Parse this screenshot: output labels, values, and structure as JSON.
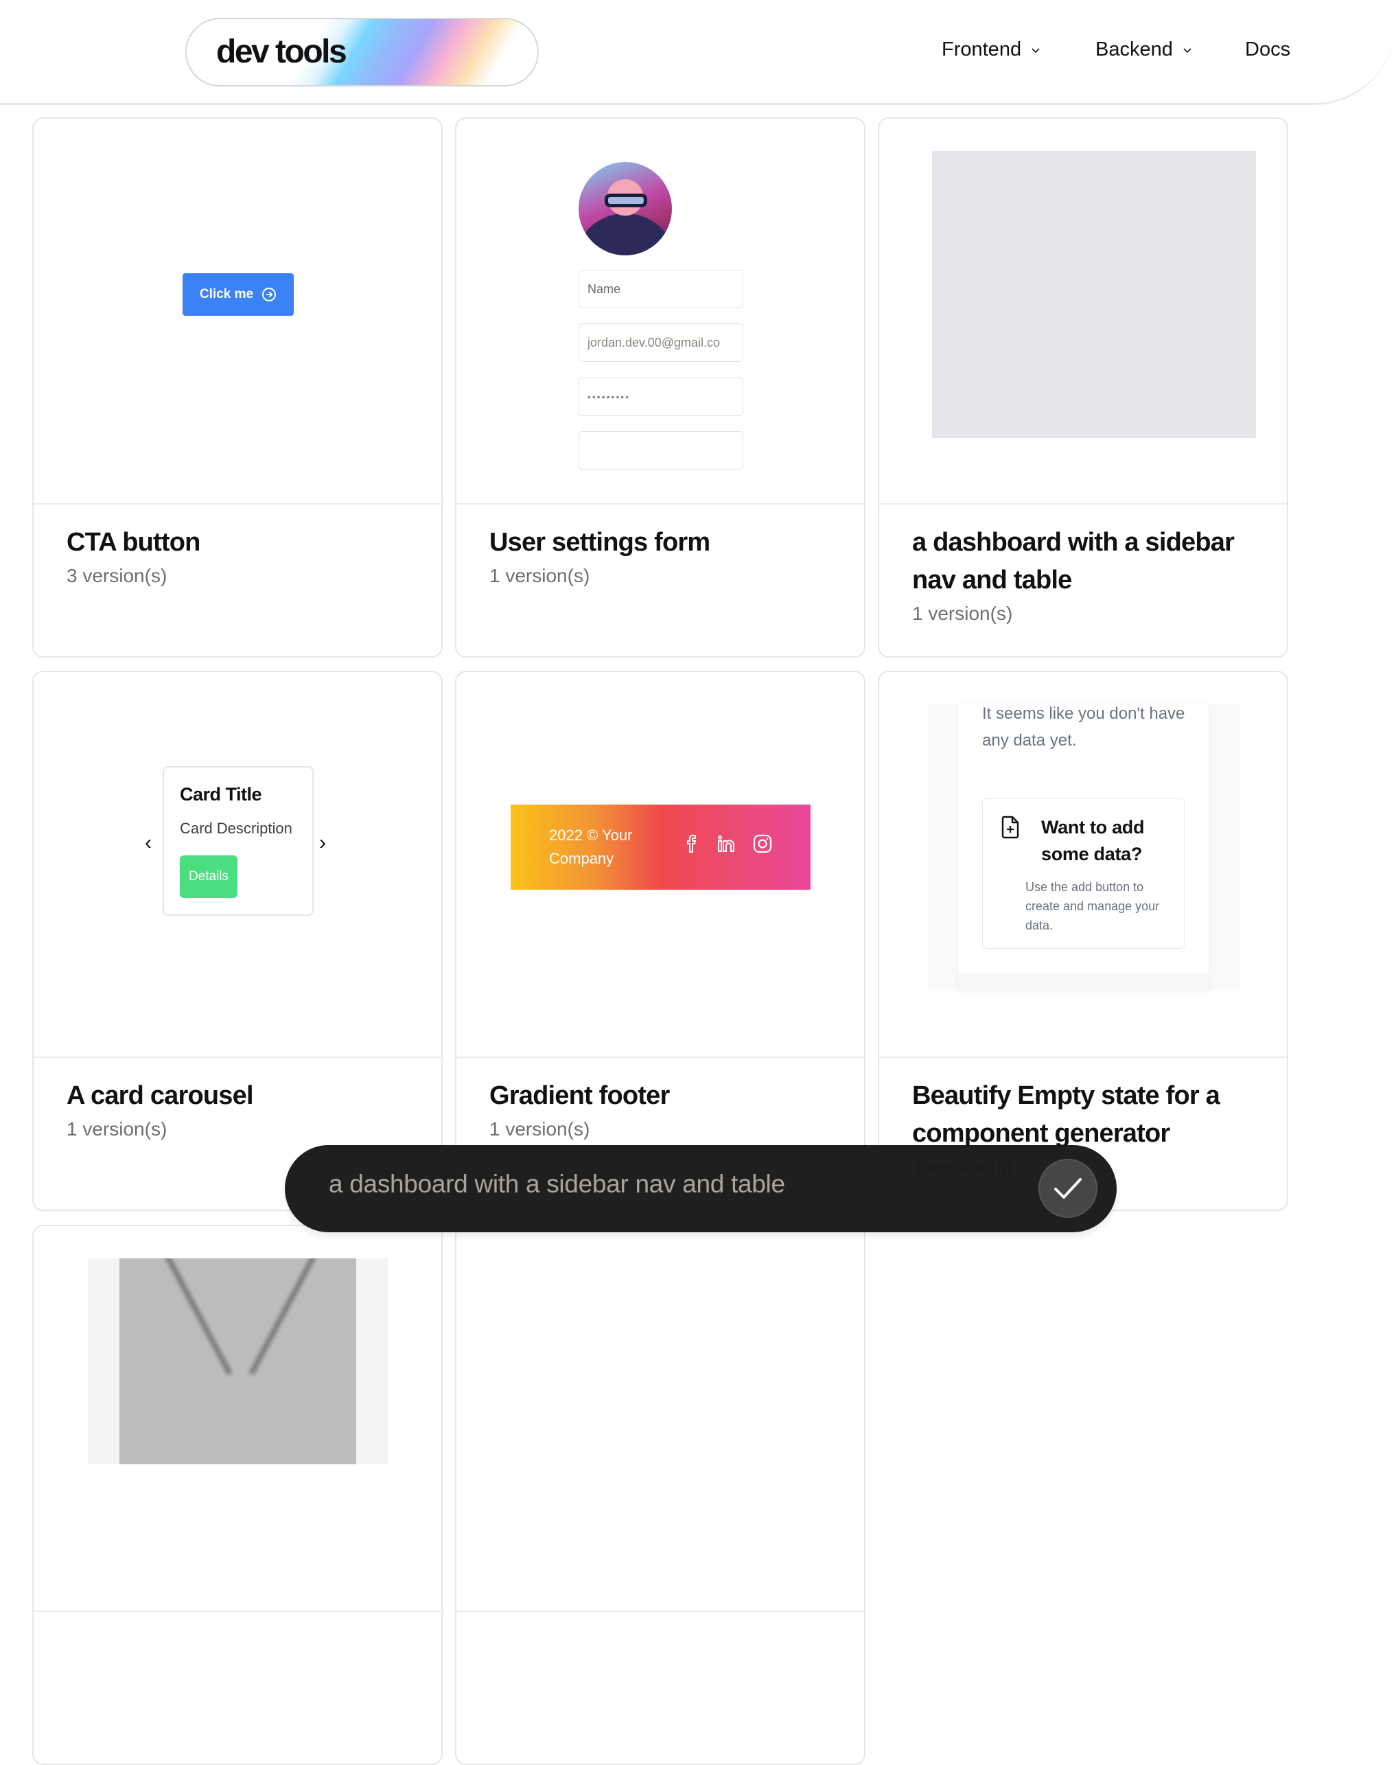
{
  "header": {
    "logo": "dev tools",
    "nav": [
      {
        "label": "Frontend",
        "has_dropdown": true
      },
      {
        "label": "Backend",
        "has_dropdown": true
      },
      {
        "label": "Docs",
        "has_dropdown": false
      }
    ]
  },
  "cards": [
    {
      "title": "CTA button",
      "versions": "3 version(s)",
      "preview": {
        "button_label": "Click me",
        "button_icon": "arrow-right-circle-icon",
        "button_color": "#3b82f6"
      }
    },
    {
      "title": "User settings form",
      "versions": "1 version(s)",
      "preview": {
        "avatar": "avatar-image",
        "fields": [
          {
            "placeholder": "Name",
            "value": ""
          },
          {
            "placeholder": "",
            "value": "jordan.dev.00@gmail.co"
          },
          {
            "placeholder": "",
            "value": "•••••••••"
          }
        ]
      }
    },
    {
      "title": "a dashboard with a sidebar nav and table",
      "versions": "1 version(s)",
      "preview": {
        "placeholder_color": "#e4e5e9"
      }
    },
    {
      "title": "A card carousel",
      "versions": "1 version(s)",
      "preview": {
        "card_title": "Card Title",
        "card_description": "Card Description",
        "button_label": "Details",
        "button_color": "#4ade80",
        "prev_icon": "chevron-left-icon",
        "next_icon": "chevron-right-icon"
      }
    },
    {
      "title": "Gradient footer",
      "versions": "1 version(s)",
      "preview": {
        "copyright": "2022 © Your Company",
        "socials": [
          "facebook-icon",
          "linkedin-icon",
          "instagram-icon"
        ]
      }
    },
    {
      "title": "Beautify Empty state for a component generator",
      "versions": "1 version(s)",
      "preview": {
        "lead": "It seems like you don't have any data yet.",
        "box_title": "Want to add some data?",
        "box_description": "Use the add button to create and manage your data.",
        "box_icon": "file-plus-icon"
      }
    }
  ],
  "prompt": {
    "text": "a dashboard with a sidebar nav and table",
    "submit_icon": "check-icon"
  }
}
